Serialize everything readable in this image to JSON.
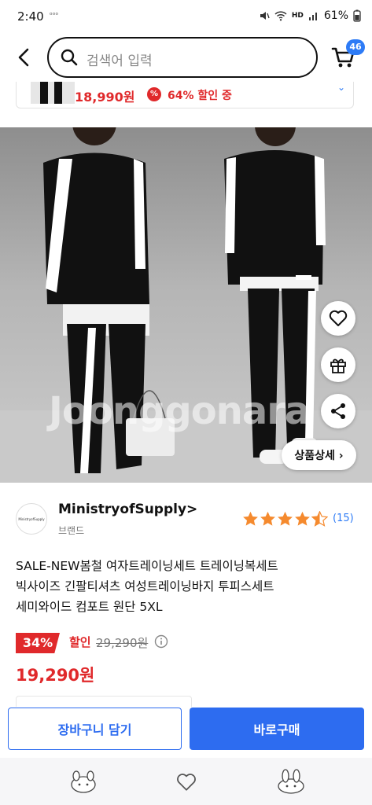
{
  "status_bar": {
    "time": "2:40",
    "small_icon_text": "ᵒᵒᵒ",
    "battery": "61%",
    "hd_label": "HD"
  },
  "search": {
    "placeholder": "검색어 입력"
  },
  "cart": {
    "badge_count": "46"
  },
  "sticky_summary": {
    "price": "18,990원",
    "discount_icon": "%",
    "discount_text": "64% 할인 중"
  },
  "hero": {
    "watermark": "Joonggonara"
  },
  "floating_actions": {
    "detail_button": "상품상세 ›"
  },
  "store": {
    "logo_text": "MinistryofSupply",
    "name": "MinistryofSupply>",
    "type": "브랜드",
    "rating_stars": 4.5,
    "review_count": "(15)"
  },
  "product": {
    "title_line1": "SALE-NEW봄철 여자트레이닝세트 트레이닝복세트",
    "title_line2": "빅사이즈 긴팔티셔츠 여성트레이닝바지 투피스세트",
    "title_line3": "세미와이드 컴포트 원단 5XL",
    "discount_rate": "34%",
    "discount_label": "할인",
    "original_price": "29,290원",
    "final_price": "19,290원"
  },
  "actions": {
    "add_to_cart": "장바구니 담기",
    "buy_now": "바로구매"
  },
  "colors": {
    "accent": "#2d6cf0",
    "sale": "#e0292b",
    "star": "#f58a2e"
  }
}
